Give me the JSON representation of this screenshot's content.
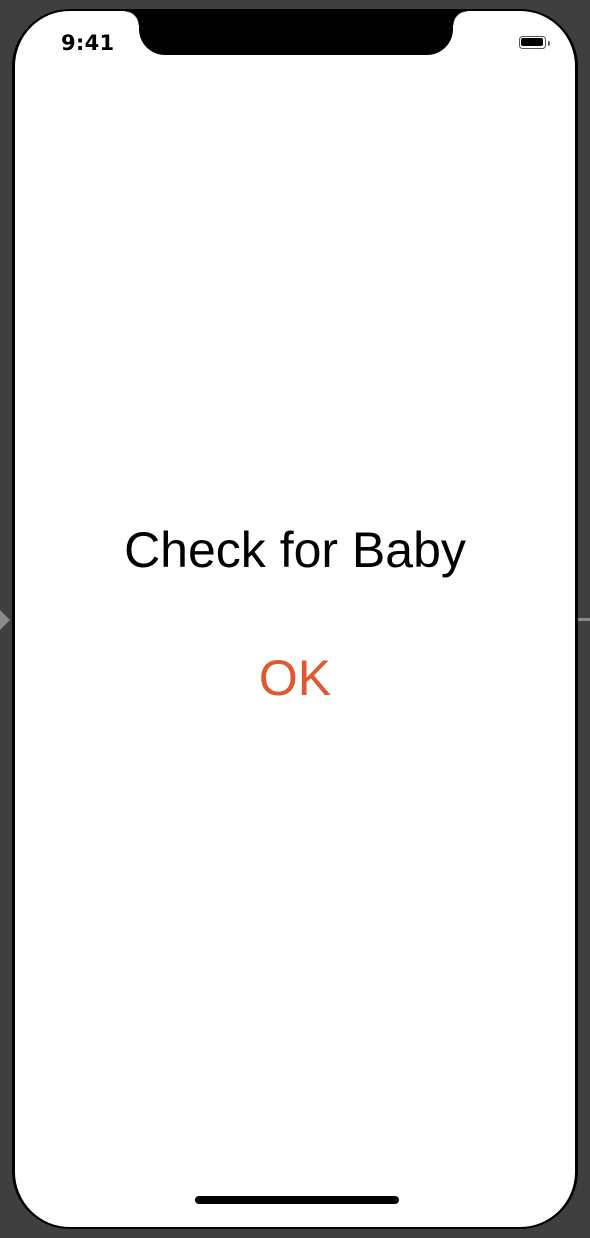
{
  "status_bar": {
    "time": "9:41",
    "battery_icon": "battery-full-icon"
  },
  "main": {
    "title": "Check for Baby",
    "ok_button_label": "OK"
  },
  "colors": {
    "accent": "#e0582f",
    "background": "#ffffff",
    "text": "#000000",
    "simulator_backdrop": "#3f3f3f"
  }
}
